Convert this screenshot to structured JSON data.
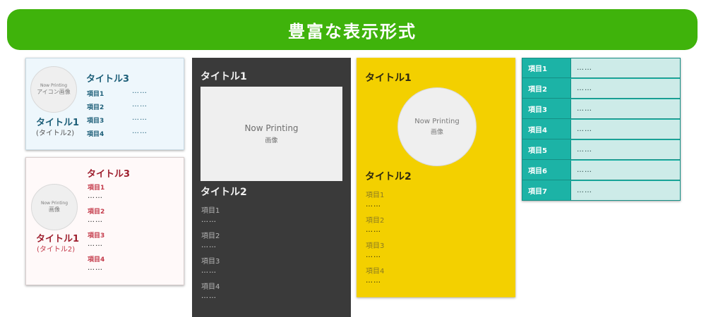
{
  "banner": {
    "title": "豊富な表示形式"
  },
  "card1": {
    "circle_line1": "Now Printing",
    "circle_line2": "アイコン画像",
    "title1": "タイトル1",
    "subtitle": "(タイトル2)",
    "title3": "タイトル3",
    "items": [
      {
        "label": "項目1",
        "value": "……"
      },
      {
        "label": "項目2",
        "value": "……"
      },
      {
        "label": "項目3",
        "value": "……"
      },
      {
        "label": "項目4",
        "value": "……"
      }
    ]
  },
  "card2": {
    "circle_line1": "Now Printing",
    "circle_line2": "画像",
    "title1": "タイトル1",
    "subtitle": "(タイトル2)",
    "title3": "タイトル3",
    "items": [
      {
        "label": "項目1",
        "value": "……"
      },
      {
        "label": "項目2",
        "value": "……"
      },
      {
        "label": "項目3",
        "value": "……"
      },
      {
        "label": "項目4",
        "value": "……"
      }
    ]
  },
  "card3": {
    "title1": "タイトル1",
    "image_line1": "Now Printing",
    "image_line2": "画像",
    "title2": "タイトル2",
    "items": [
      {
        "label": "項目1",
        "value": "……"
      },
      {
        "label": "項目2",
        "value": "……"
      },
      {
        "label": "項目3",
        "value": "……"
      },
      {
        "label": "項目4",
        "value": "……"
      }
    ]
  },
  "card4": {
    "title1": "タイトル1",
    "circle_line1": "Now Printing",
    "circle_line2": "画像",
    "title2": "タイトル2",
    "items": [
      {
        "label": "項目1",
        "value": "……"
      },
      {
        "label": "項目2",
        "value": "……"
      },
      {
        "label": "項目3",
        "value": "……"
      },
      {
        "label": "項目4",
        "value": "……"
      }
    ]
  },
  "card5": {
    "rows": [
      {
        "label": "項目1",
        "value": "……"
      },
      {
        "label": "項目2",
        "value": "……"
      },
      {
        "label": "項目3",
        "value": "……"
      },
      {
        "label": "項目4",
        "value": "……"
      },
      {
        "label": "項目5",
        "value": "……"
      },
      {
        "label": "項目6",
        "value": "……"
      },
      {
        "label": "項目7",
        "value": "……"
      }
    ]
  },
  "colors": {
    "banner": "#3fb30b",
    "blue_accent": "#1c5e78",
    "red_accent": "#c43a4a",
    "dark_card": "#3a3a3a",
    "yellow_card": "#f3d000",
    "teal_card": "#1cb3a6"
  }
}
